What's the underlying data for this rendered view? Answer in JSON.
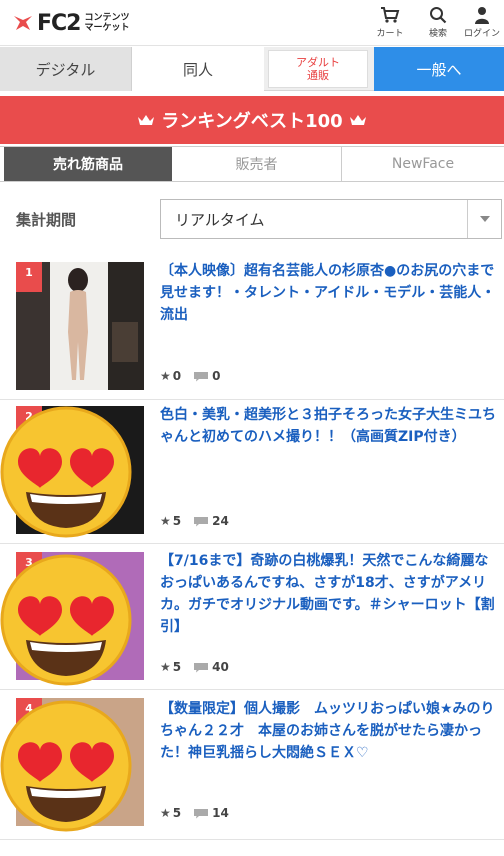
{
  "header": {
    "logo_text": "FC2",
    "logo_sub_line1": "コンテンツ",
    "logo_sub_line2": "マーケット",
    "cart_label": "カート",
    "search_label": "検索",
    "login_label": "ログイン"
  },
  "category_tabs": {
    "digital": "デジタル",
    "doujin": "同人",
    "adult_line1": "アダルト",
    "adult_line2": "通販",
    "general": "一般へ"
  },
  "ranking_banner": {
    "title": "ランキングベスト100"
  },
  "sub_tabs": {
    "best_selling": "売れ筋商品",
    "seller": "販売者",
    "newface": "NewFace"
  },
  "period": {
    "label": "集計期間",
    "selected": "リアルタイム"
  },
  "items": [
    {
      "rank": "1",
      "title": "〔本人映像〕超有名芸能人の杉原杏●のお尻の穴まで見せます！・タレント・アイドル・モデル・芸能人・流出",
      "stars": "0",
      "comments": "0"
    },
    {
      "rank": "2",
      "title": "色白・美乳・超美形と３拍子そろった女子大生ミユちゃんと初めてのハメ撮り！！（高画質ZIP付き）",
      "stars": "5",
      "comments": "24"
    },
    {
      "rank": "3",
      "title": "【7/16まで】奇跡の白桃爆乳！天然でこんな綺麗なおっぱいあるんですね、さすが18才、さすがアメリカ。ガチでオリジナル動画です。＃シャーロット【割引】",
      "stars": "5",
      "comments": "40"
    },
    {
      "rank": "4",
      "title": "【数量限定】個人撮影　ムッツリおっぱい娘★みのりちゃん２２才　本屋のお姉さんを脱がせたら凄かった！神巨乳揺らし大悶絶ＳＥＸ♡",
      "stars": "5",
      "comments": "14"
    }
  ],
  "colors": {
    "brand_red": "#e94c4c",
    "link_blue": "#1a5fbf",
    "general_blue": "#2e8ee8",
    "active_tab": "#555555"
  },
  "icons": [
    "cart-icon",
    "search-icon",
    "user-icon",
    "crown-icon",
    "star-icon",
    "comment-icon",
    "dropdown-caret-icon",
    "heart-eyes-emoji"
  ]
}
